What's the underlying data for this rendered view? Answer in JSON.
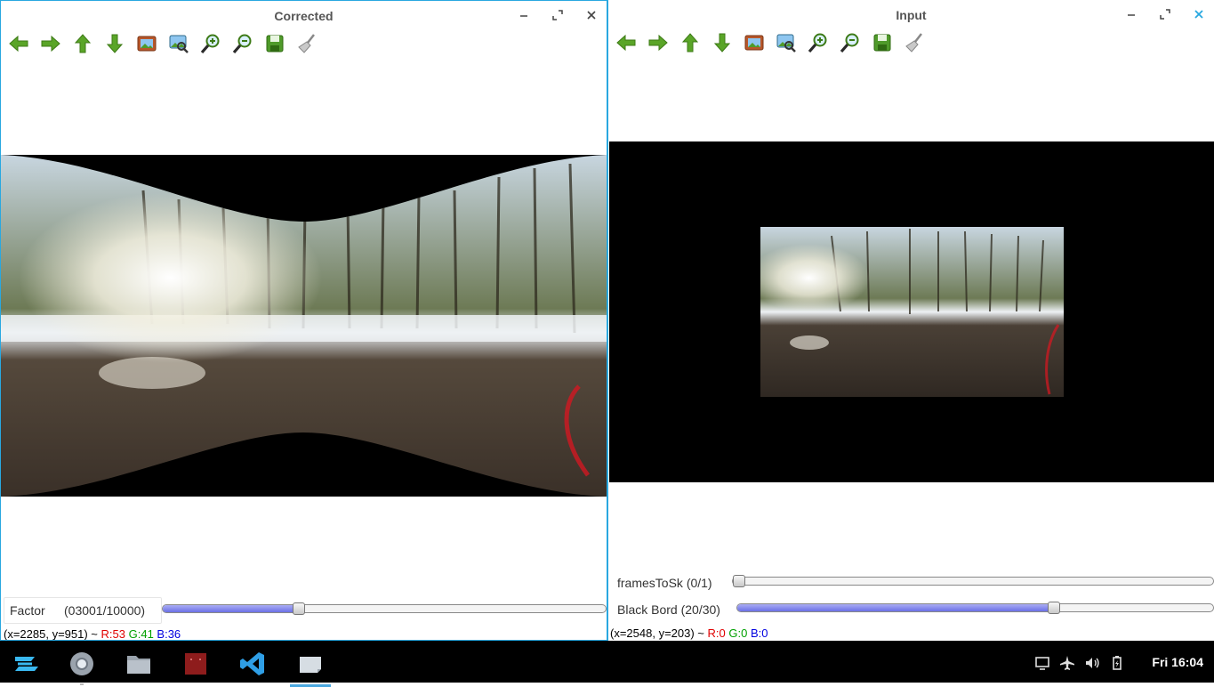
{
  "windows": {
    "left": {
      "title": "Corrected",
      "trackbars": [
        {
          "label": "Factor",
          "value_text": "(03001/10000)",
          "fraction": 0.3001
        }
      ],
      "status": {
        "coords": "(x=2285, y=951) ~",
        "r": "R:53",
        "g": "G:41",
        "b": "B:36"
      }
    },
    "right": {
      "title": "Input",
      "trackbars": [
        {
          "label": "framesToSk",
          "value_text": "(0/1)",
          "fraction": 0.0
        },
        {
          "label": "Black Bord",
          "value_text": "(20/30)",
          "fraction": 0.6667
        }
      ],
      "status": {
        "coords": "(x=2548, y=203) ~",
        "r": "R:0",
        "g": "G:0",
        "b": "B:0"
      }
    }
  },
  "toolbar_icons": [
    "arrow-left-icon",
    "arrow-right-icon",
    "arrow-up-icon",
    "arrow-down-icon",
    "image-icon",
    "zoom-fit-icon",
    "zoom-in-icon",
    "zoom-out-icon",
    "save-icon",
    "clear-icon"
  ],
  "taskbar": {
    "apps": [
      "zorin-menu-icon",
      "chrome-icon",
      "files-icon",
      "app-red-icon",
      "vscode-icon",
      "image-viewer-icon"
    ],
    "tray": [
      "display-icon",
      "airplane-icon",
      "volume-icon",
      "battery-icon"
    ],
    "clock": "Fri 16:04"
  },
  "colors": {
    "accent": "#29a8e0",
    "slider_fill": "#7b80ea",
    "taskbar": "#000000"
  }
}
